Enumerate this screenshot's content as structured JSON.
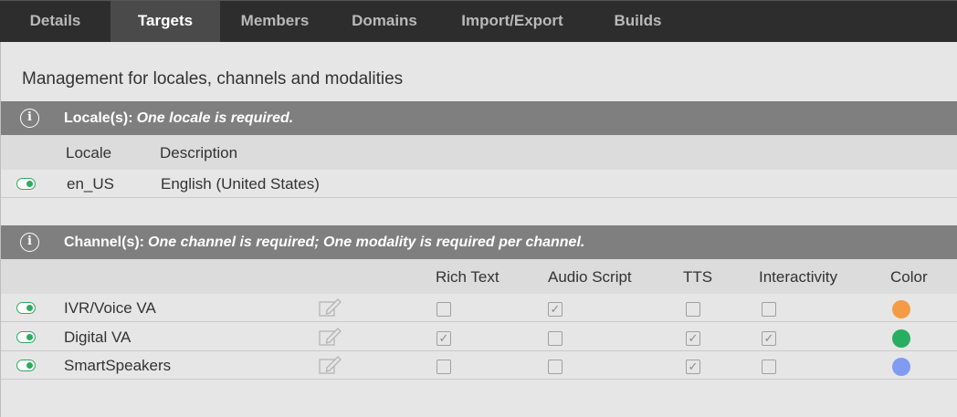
{
  "tabs": [
    {
      "label": "Details",
      "active": false
    },
    {
      "label": "Targets",
      "active": true
    },
    {
      "label": "Members",
      "active": false
    },
    {
      "label": "Domains",
      "active": false
    },
    {
      "label": "Import/Export",
      "active": false
    },
    {
      "label": "Builds",
      "active": false
    }
  ],
  "subtitle": "Management for locales, channels and modalities",
  "locales": {
    "title": "Locale(s):",
    "note": "One locale is required.",
    "headers": {
      "locale": "Locale",
      "description": "Description"
    },
    "rows": [
      {
        "locale": "en_US",
        "description": "English (United States)",
        "enabled": true
      }
    ]
  },
  "channels": {
    "title": "Channel(s):",
    "note": "One channel is required; One modality is required per channel.",
    "headers": {
      "rich_text": "Rich Text",
      "audio_script": "Audio Script",
      "tts": "TTS",
      "interactivity": "Interactivity",
      "color": "Color"
    },
    "rows": [
      {
        "name": "IVR/Voice VA",
        "enabled": true,
        "rich_text": false,
        "audio_script": true,
        "tts": false,
        "interactivity": false,
        "color": "#f39c45"
      },
      {
        "name": "Digital VA",
        "enabled": true,
        "rich_text": true,
        "audio_script": false,
        "tts": true,
        "interactivity": true,
        "color": "#27ae60"
      },
      {
        "name": "SmartSpeakers",
        "enabled": true,
        "rich_text": false,
        "audio_script": false,
        "tts": true,
        "interactivity": false,
        "color": "#7f9cf2"
      }
    ]
  },
  "icons": {
    "info": "info-icon",
    "toggle": "toggle-on-icon",
    "edit": "edit-icon",
    "check": "✓"
  }
}
